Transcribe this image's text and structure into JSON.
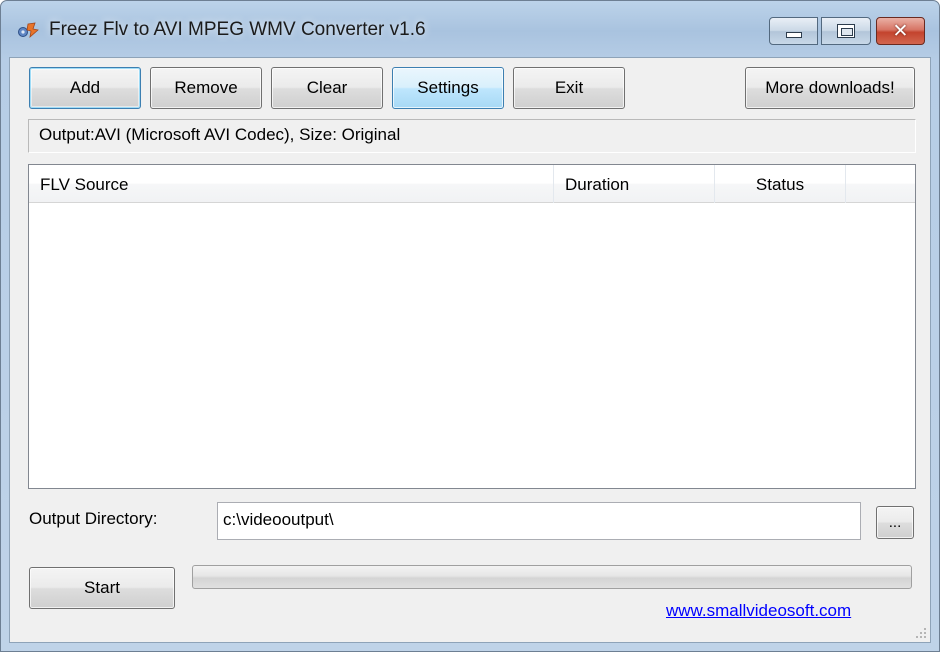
{
  "window": {
    "title": "Freez Flv to AVI MPEG WMV Converter v1.6",
    "close_glyph": "✕"
  },
  "toolbar": {
    "add_label": "Add",
    "remove_label": "Remove",
    "clear_label": "Clear",
    "settings_label": "Settings",
    "exit_label": "Exit",
    "more_downloads_label": "More downloads!"
  },
  "output_info": "Output:AVI (Microsoft AVI Codec), Size: Original",
  "file_list": {
    "columns": [
      "FLV Source",
      "Duration",
      "Status",
      ""
    ],
    "rows": []
  },
  "output_directory": {
    "label": "Output Directory:",
    "value": "c:\\videooutput\\",
    "browse_label": "..."
  },
  "start_label": "Start",
  "progress": {
    "percent": 0
  },
  "website_link": "www.smallvideosoft.com",
  "icons": {
    "app": "converter-app-icon",
    "minimize": "minimize-icon",
    "maximize": "maximize-icon",
    "close": "close-icon",
    "grip": "resize-grip-icon"
  },
  "colors": {
    "link": "#0000ff",
    "title_bar": "#b6cde6",
    "close_button": "#c3442e",
    "focus_border": "#3c7fb1"
  }
}
